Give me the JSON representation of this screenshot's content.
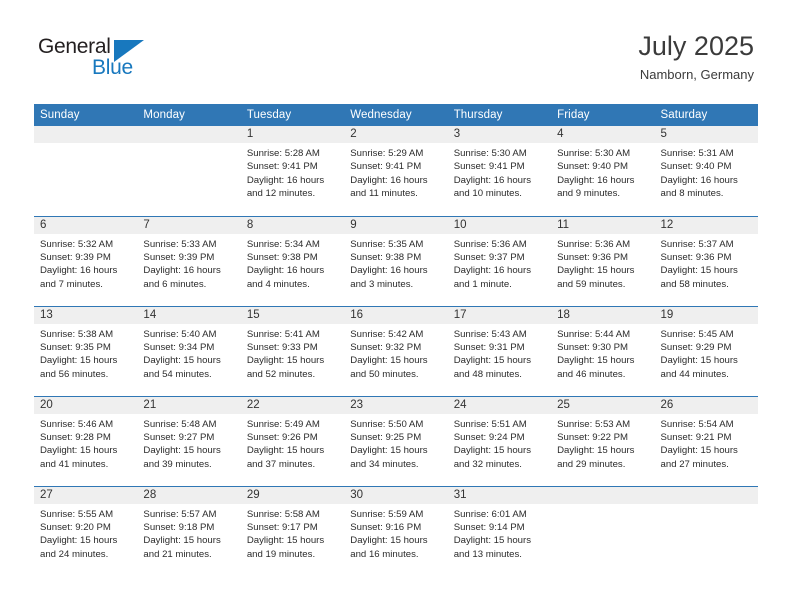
{
  "brand": {
    "name_part1": "General",
    "name_part2": "Blue",
    "triangle_icon": "triangle-icon",
    "accent_color": "#1878be"
  },
  "header": {
    "title": "July 2025",
    "location": "Namborn, Germany"
  },
  "theme": {
    "header_blue": "#3077B5",
    "daynum_band": "#EFEFEF",
    "text": "#2B2B2B"
  },
  "calendar": {
    "weekday_headers": [
      "Sunday",
      "Monday",
      "Tuesday",
      "Wednesday",
      "Thursday",
      "Friday",
      "Saturday"
    ],
    "weeks": [
      [
        {
          "day": "",
          "lines": []
        },
        {
          "day": "",
          "lines": []
        },
        {
          "day": "1",
          "lines": [
            "Sunrise: 5:28 AM",
            "Sunset: 9:41 PM",
            "Daylight: 16 hours",
            "and 12 minutes."
          ]
        },
        {
          "day": "2",
          "lines": [
            "Sunrise: 5:29 AM",
            "Sunset: 9:41 PM",
            "Daylight: 16 hours",
            "and 11 minutes."
          ]
        },
        {
          "day": "3",
          "lines": [
            "Sunrise: 5:30 AM",
            "Sunset: 9:41 PM",
            "Daylight: 16 hours",
            "and 10 minutes."
          ]
        },
        {
          "day": "4",
          "lines": [
            "Sunrise: 5:30 AM",
            "Sunset: 9:40 PM",
            "Daylight: 16 hours",
            "and 9 minutes."
          ]
        },
        {
          "day": "5",
          "lines": [
            "Sunrise: 5:31 AM",
            "Sunset: 9:40 PM",
            "Daylight: 16 hours",
            "and 8 minutes."
          ]
        }
      ],
      [
        {
          "day": "6",
          "lines": [
            "Sunrise: 5:32 AM",
            "Sunset: 9:39 PM",
            "Daylight: 16 hours",
            "and 7 minutes."
          ]
        },
        {
          "day": "7",
          "lines": [
            "Sunrise: 5:33 AM",
            "Sunset: 9:39 PM",
            "Daylight: 16 hours",
            "and 6 minutes."
          ]
        },
        {
          "day": "8",
          "lines": [
            "Sunrise: 5:34 AM",
            "Sunset: 9:38 PM",
            "Daylight: 16 hours",
            "and 4 minutes."
          ]
        },
        {
          "day": "9",
          "lines": [
            "Sunrise: 5:35 AM",
            "Sunset: 9:38 PM",
            "Daylight: 16 hours",
            "and 3 minutes."
          ]
        },
        {
          "day": "10",
          "lines": [
            "Sunrise: 5:36 AM",
            "Sunset: 9:37 PM",
            "Daylight: 16 hours",
            "and 1 minute."
          ]
        },
        {
          "day": "11",
          "lines": [
            "Sunrise: 5:36 AM",
            "Sunset: 9:36 PM",
            "Daylight: 15 hours",
            "and 59 minutes."
          ]
        },
        {
          "day": "12",
          "lines": [
            "Sunrise: 5:37 AM",
            "Sunset: 9:36 PM",
            "Daylight: 15 hours",
            "and 58 minutes."
          ]
        }
      ],
      [
        {
          "day": "13",
          "lines": [
            "Sunrise: 5:38 AM",
            "Sunset: 9:35 PM",
            "Daylight: 15 hours",
            "and 56 minutes."
          ]
        },
        {
          "day": "14",
          "lines": [
            "Sunrise: 5:40 AM",
            "Sunset: 9:34 PM",
            "Daylight: 15 hours",
            "and 54 minutes."
          ]
        },
        {
          "day": "15",
          "lines": [
            "Sunrise: 5:41 AM",
            "Sunset: 9:33 PM",
            "Daylight: 15 hours",
            "and 52 minutes."
          ]
        },
        {
          "day": "16",
          "lines": [
            "Sunrise: 5:42 AM",
            "Sunset: 9:32 PM",
            "Daylight: 15 hours",
            "and 50 minutes."
          ]
        },
        {
          "day": "17",
          "lines": [
            "Sunrise: 5:43 AM",
            "Sunset: 9:31 PM",
            "Daylight: 15 hours",
            "and 48 minutes."
          ]
        },
        {
          "day": "18",
          "lines": [
            "Sunrise: 5:44 AM",
            "Sunset: 9:30 PM",
            "Daylight: 15 hours",
            "and 46 minutes."
          ]
        },
        {
          "day": "19",
          "lines": [
            "Sunrise: 5:45 AM",
            "Sunset: 9:29 PM",
            "Daylight: 15 hours",
            "and 44 minutes."
          ]
        }
      ],
      [
        {
          "day": "20",
          "lines": [
            "Sunrise: 5:46 AM",
            "Sunset: 9:28 PM",
            "Daylight: 15 hours",
            "and 41 minutes."
          ]
        },
        {
          "day": "21",
          "lines": [
            "Sunrise: 5:48 AM",
            "Sunset: 9:27 PM",
            "Daylight: 15 hours",
            "and 39 minutes."
          ]
        },
        {
          "day": "22",
          "lines": [
            "Sunrise: 5:49 AM",
            "Sunset: 9:26 PM",
            "Daylight: 15 hours",
            "and 37 minutes."
          ]
        },
        {
          "day": "23",
          "lines": [
            "Sunrise: 5:50 AM",
            "Sunset: 9:25 PM",
            "Daylight: 15 hours",
            "and 34 minutes."
          ]
        },
        {
          "day": "24",
          "lines": [
            "Sunrise: 5:51 AM",
            "Sunset: 9:24 PM",
            "Daylight: 15 hours",
            "and 32 minutes."
          ]
        },
        {
          "day": "25",
          "lines": [
            "Sunrise: 5:53 AM",
            "Sunset: 9:22 PM",
            "Daylight: 15 hours",
            "and 29 minutes."
          ]
        },
        {
          "day": "26",
          "lines": [
            "Sunrise: 5:54 AM",
            "Sunset: 9:21 PM",
            "Daylight: 15 hours",
            "and 27 minutes."
          ]
        }
      ],
      [
        {
          "day": "27",
          "lines": [
            "Sunrise: 5:55 AM",
            "Sunset: 9:20 PM",
            "Daylight: 15 hours",
            "and 24 minutes."
          ]
        },
        {
          "day": "28",
          "lines": [
            "Sunrise: 5:57 AM",
            "Sunset: 9:18 PM",
            "Daylight: 15 hours",
            "and 21 minutes."
          ]
        },
        {
          "day": "29",
          "lines": [
            "Sunrise: 5:58 AM",
            "Sunset: 9:17 PM",
            "Daylight: 15 hours",
            "and 19 minutes."
          ]
        },
        {
          "day": "30",
          "lines": [
            "Sunrise: 5:59 AM",
            "Sunset: 9:16 PM",
            "Daylight: 15 hours",
            "and 16 minutes."
          ]
        },
        {
          "day": "31",
          "lines": [
            "Sunrise: 6:01 AM",
            "Sunset: 9:14 PM",
            "Daylight: 15 hours",
            "and 13 minutes."
          ]
        },
        {
          "day": "",
          "lines": []
        },
        {
          "day": "",
          "lines": []
        }
      ]
    ]
  }
}
